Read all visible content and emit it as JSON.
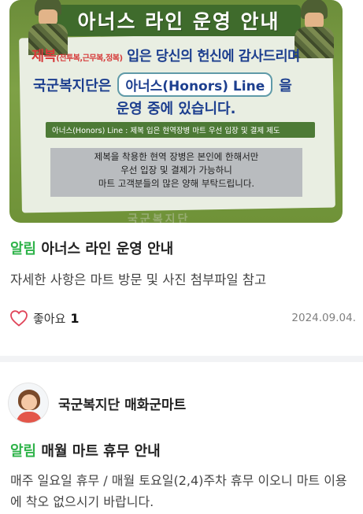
{
  "post1": {
    "image": {
      "banner": "아너스 라인 운영 안내",
      "line1_red": "제복",
      "line1_small": "(전투복,근무복,정복)",
      "line1_rest": " 입은 당신의 헌신에 감사드리며",
      "line2_prefix": "국군복지단은",
      "line2_pill": "아너스(Honors) Line",
      "line2_suffix": "을",
      "line3": "운영 중에 있습니다.",
      "line4": "아너스(Honors) Line : 제복 입은 현역장병 마트 우선 입장 및 결제 제도",
      "line5a": "제복을 착용한 현역 장병은 본인에 한해서만",
      "line5b": "우선 입장 및 결제가 가능하니",
      "line5c": "마트 고객분들의 많은 양해 부탁드립니다.",
      "bottom_mark": "국군복지단"
    },
    "tag": "알림",
    "title": "아너스 라인 운영 안내",
    "description": "자세한 사항은 마트 방문 및 사진 첨부파일 참고",
    "like_label": "좋아요",
    "like_count": "1",
    "date": "2024.09.04."
  },
  "post2": {
    "author": "국군복지단 매화군마트",
    "tag": "알림",
    "title": "매월 마트 휴무 안내",
    "description": "매주 일요일 휴무 / 매월 토요일(2,4)주차 휴무 이오니 마트 이용에 착오 없으시기 바랍니다."
  },
  "colors": {
    "tag": "#2fb34a",
    "heart": "#e0455a",
    "poster_text": "#1d3f8f"
  },
  "icons": [
    "heart-icon",
    "avatar"
  ]
}
